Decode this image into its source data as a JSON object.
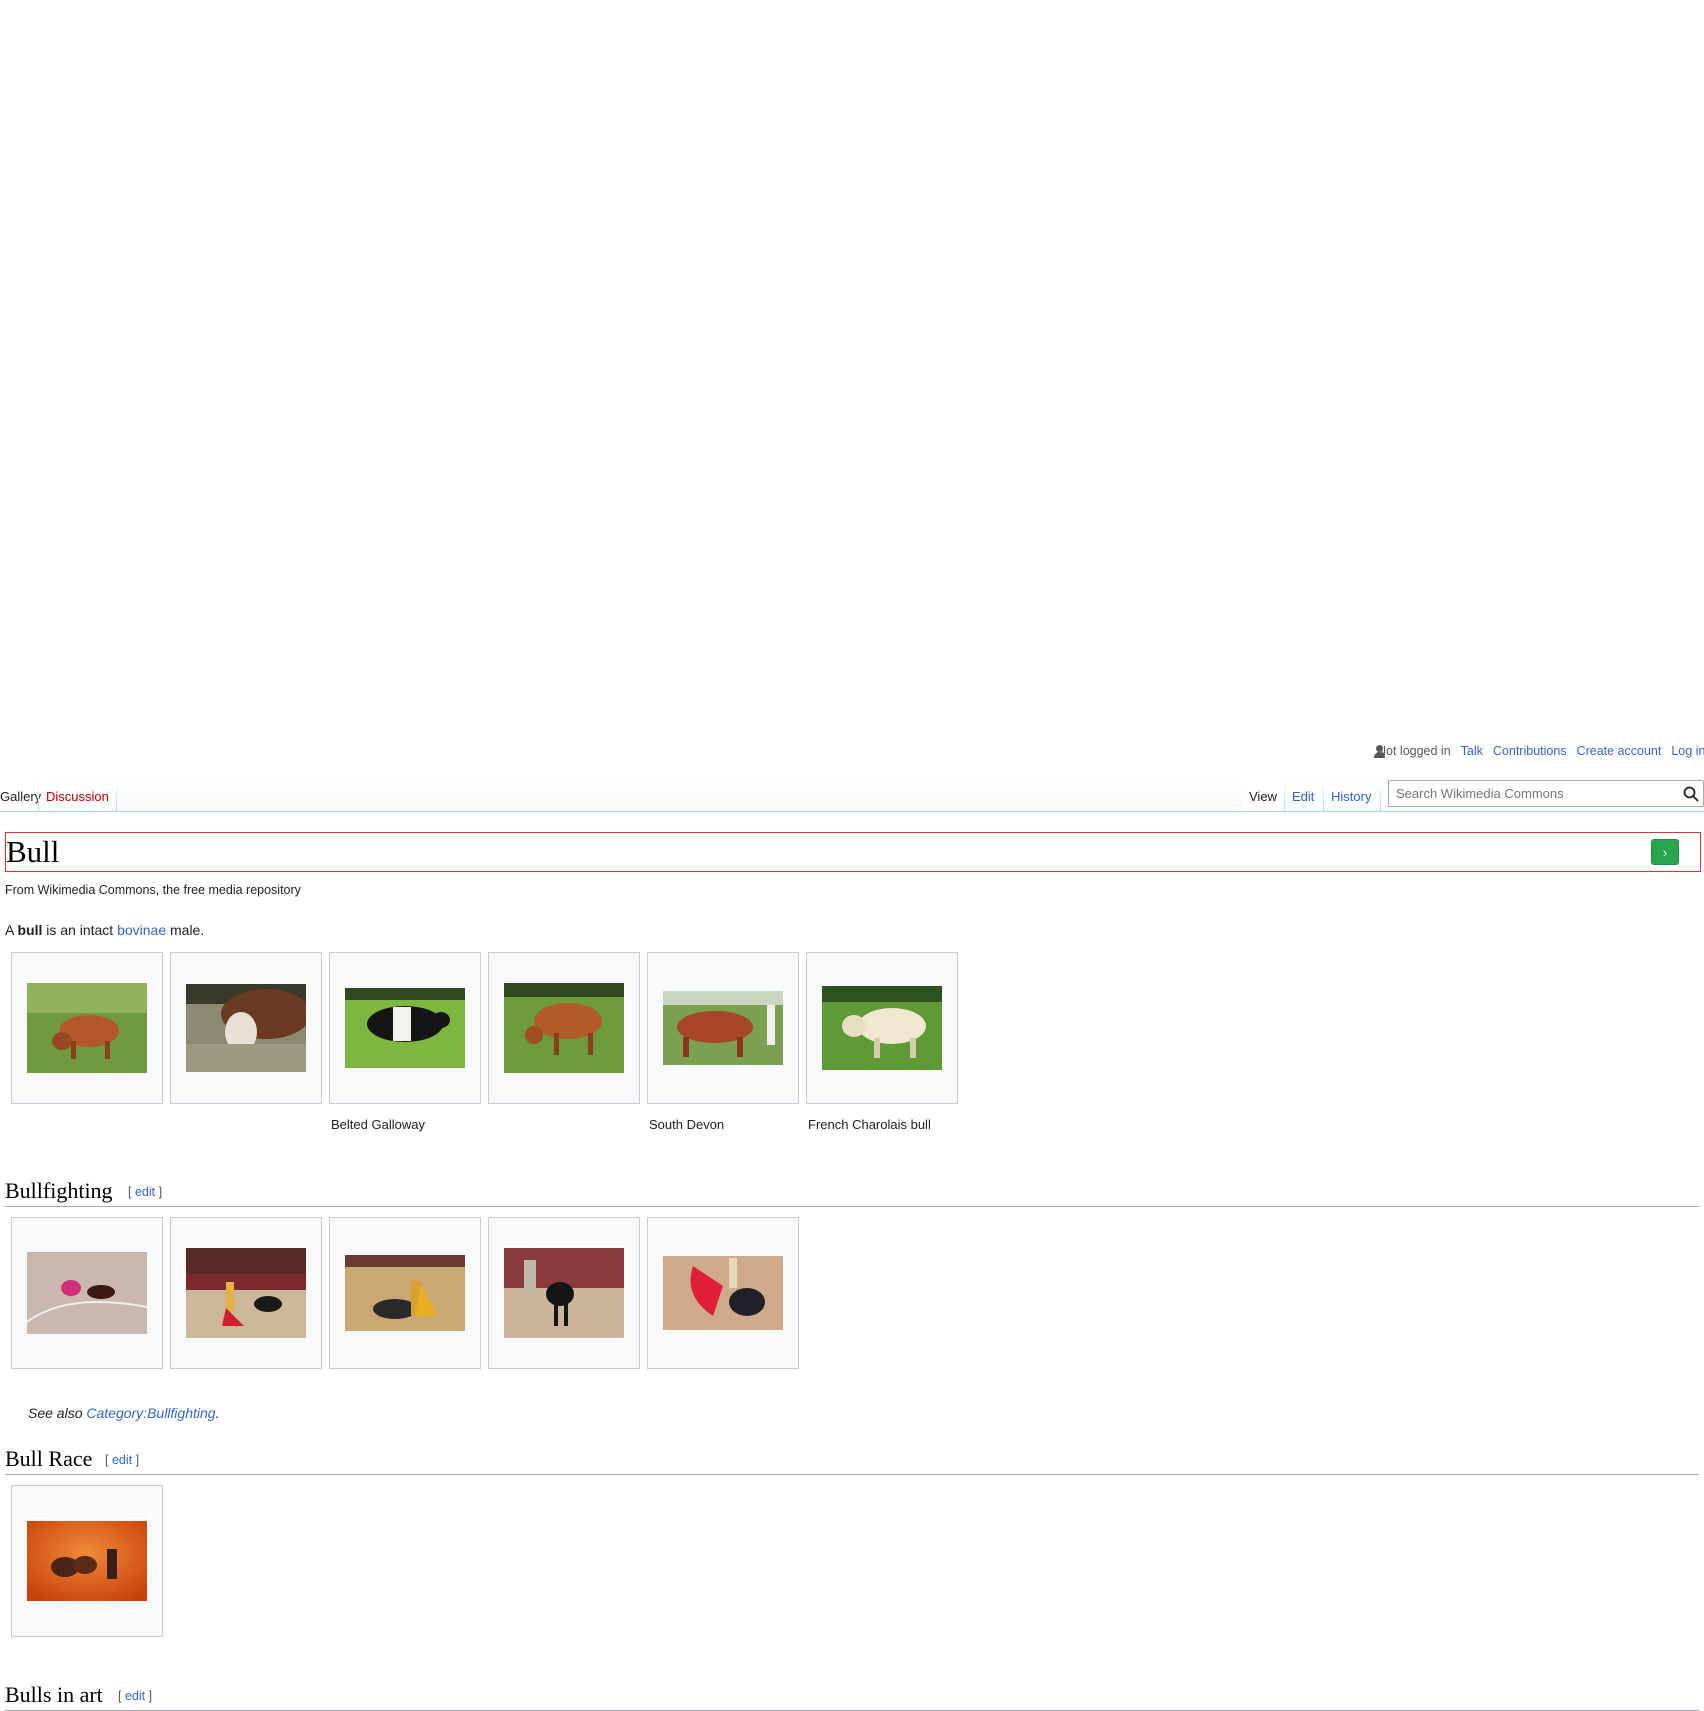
{
  "personal": {
    "not_logged_in": "Not logged in",
    "talk": "Talk",
    "contributions": "Contributions",
    "create_account": "Create account",
    "log_in": "Log in"
  },
  "tabs": {
    "gallery": "Gallery",
    "discussion": "Discussion",
    "view": "View",
    "edit": "Edit",
    "history": "History"
  },
  "search": {
    "placeholder": "Search Wikimedia Commons"
  },
  "page": {
    "title": "Bull",
    "go_label": "›",
    "site_sub": "From Wikimedia Commons, the free media repository",
    "intro_a": "A ",
    "intro_bold": "bull",
    "intro_mid": " is an intact ",
    "intro_link": "bovinae",
    "intro_end": " male."
  },
  "gallery_main": {
    "captions": [
      "",
      "",
      "Belted Galloway",
      "",
      "South Devon",
      "French Charolais bull"
    ]
  },
  "sections": {
    "bullfighting": {
      "title": "Bullfighting",
      "edit": "edit"
    },
    "bull_race": {
      "title": "Bull Race",
      "edit": "edit"
    },
    "bulls_in_art": {
      "title": "Bulls in art",
      "edit": "edit"
    }
  },
  "see_also": {
    "prefix": "See also ",
    "link": "Category:Bullfighting",
    "suffix": "."
  },
  "colors": {
    "link": "#3366cc",
    "new_link": "#ba0000",
    "heading_outline": "#dd3333",
    "go_button": "#2aa44f"
  }
}
